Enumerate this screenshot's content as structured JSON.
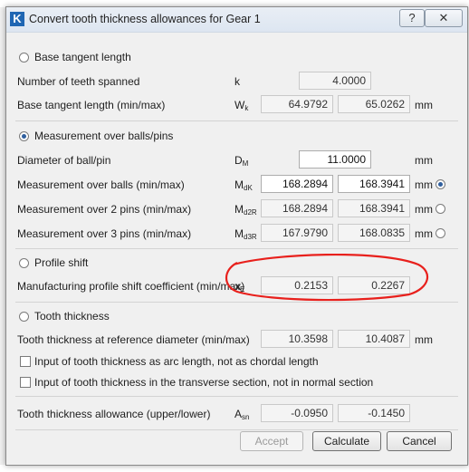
{
  "window": {
    "title": "Convert tooth thickness allowances for Gear 1",
    "icon_letter": "K",
    "help_glyph": "?",
    "close_glyph": "✕"
  },
  "base_tangent": {
    "radio_label": "Base tangent length",
    "teeth_label": "Number of teeth spanned",
    "teeth_symbol": "k",
    "teeth_value": "4.0000",
    "length_label": "Base tangent length (min/max)",
    "length_symbol": "W",
    "length_sub": "k",
    "length_min": "64.9792",
    "length_max": "65.0262",
    "unit": "mm"
  },
  "measurement": {
    "radio_label": "Measurement over balls/pins",
    "diameter_label": "Diameter of ball/pin",
    "diameter_symbol": "D",
    "diameter_sub": "M",
    "diameter_value": "11.0000",
    "unit": "mm",
    "balls_label": "Measurement over balls (min/max)",
    "balls_symbol": "M",
    "balls_sub": "dK",
    "balls_min": "168.2894",
    "balls_max": "168.3941",
    "pins2_label": "Measurement over 2 pins (min/max)",
    "pins2_symbol": "M",
    "pins2_sub": "d2R",
    "pins2_min": "168.2894",
    "pins2_max": "168.3941",
    "pins3_label": "Measurement over 3 pins (min/max)",
    "pins3_symbol": "M",
    "pins3_sub": "d3R",
    "pins3_min": "167.9790",
    "pins3_max": "168.0835"
  },
  "profile_shift": {
    "radio_label": "Profile shift",
    "coef_label": "Manufacturing profile shift coefficient (min/max)",
    "coef_symbol": "x",
    "coef_sub": "E",
    "coef_min": "0.2153",
    "coef_max": "0.2267"
  },
  "tooth_thickness": {
    "radio_label": "Tooth thickness",
    "ref_label": "Tooth thickness at reference diameter (min/max)",
    "ref_min": "10.3598",
    "ref_max": "10.4087",
    "unit": "mm",
    "check_arc": "Input of tooth thickness as arc length, not as chordal length",
    "check_transverse": "Input of tooth thickness in the transverse section, not in normal section"
  },
  "allowance": {
    "label": "Tooth thickness allowance (upper/lower)",
    "symbol": "A",
    "sub": "sn",
    "upper": "-0.0950",
    "lower": "-0.1450"
  },
  "buttons": {
    "accept": "Accept",
    "calculate": "Calculate",
    "cancel": "Cancel"
  },
  "colors": {
    "annotation": "#e8201c",
    "icon_blue": "#1f66b3"
  }
}
